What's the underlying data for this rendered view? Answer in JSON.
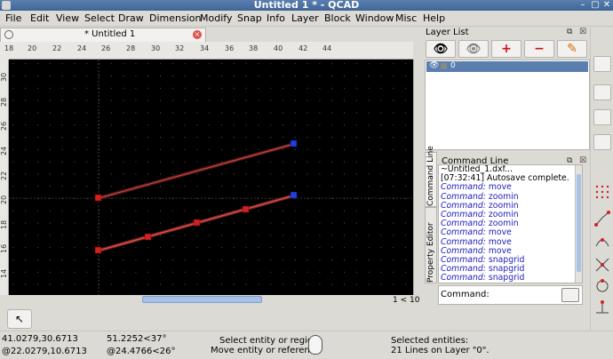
{
  "window": {
    "title": "Untitled 1 * - QCAD",
    "minimize_glyph": "–",
    "maximize_glyph": "▢",
    "close_glyph": "✕"
  },
  "menubar": {
    "items": [
      {
        "label": "File"
      },
      {
        "label": "Edit"
      },
      {
        "label": "View"
      },
      {
        "label": "Select"
      },
      {
        "label": "Draw"
      },
      {
        "label": "Dimension"
      },
      {
        "label": "Modify"
      },
      {
        "label": "Snap"
      },
      {
        "label": "Info"
      },
      {
        "label": "Layer"
      },
      {
        "label": "Block"
      },
      {
        "label": "Window"
      },
      {
        "label": "Misc"
      },
      {
        "label": "Help"
      }
    ]
  },
  "document_tab": {
    "label": "* Untitled 1",
    "close_glyph": "×"
  },
  "ruler": {
    "horizontal_ticks": [
      "20",
      "22",
      "24",
      "26",
      "28",
      "30",
      "32",
      "34",
      "36",
      "38",
      "40",
      "42",
      "44"
    ],
    "vertical_ticks": [
      "30",
      "28",
      "26",
      "24",
      "22",
      "20",
      "18",
      "16",
      "14",
      "12",
      "10",
      "8",
      "6",
      "4",
      "2"
    ],
    "horizontal_first": "18"
  },
  "canvas": {
    "background": "#000000",
    "grid_color": "#5a5a5a",
    "axis_color": "#8a8a8a",
    "line_color": "#b8322e",
    "endpoint_red": "#d42020",
    "endpoint_blue": "#2040e0"
  },
  "scroll": {
    "page_indicator": "1 < 10"
  },
  "layer_list": {
    "title": "Layer List",
    "buttons": {
      "show_all": "👁",
      "hide_all": "👁",
      "add": "+",
      "remove": "−",
      "edit": "✎"
    },
    "layers": [
      {
        "name": "0",
        "visible": true,
        "locked": false
      }
    ]
  },
  "command_line": {
    "title": "Command Line",
    "side_tabs": {
      "command_line": "Command Line",
      "property_editor": "Property Editor"
    },
    "history": [
      {
        "text": "~Untitled_1.dxf...",
        "kind": "info"
      },
      {
        "text": "[07:32:41] Autosave complete.",
        "kind": "info"
      },
      {
        "prefix": "Command:",
        "text": " move",
        "kind": "cmd"
      },
      {
        "prefix": "Command:",
        "text": " zoomin",
        "kind": "cmd"
      },
      {
        "prefix": "Command:",
        "text": " zoomin",
        "kind": "cmd"
      },
      {
        "prefix": "Command:",
        "text": " zoomin",
        "kind": "cmd"
      },
      {
        "prefix": "Command:",
        "text": " zoomin",
        "kind": "cmd"
      },
      {
        "prefix": "Command:",
        "text": " move",
        "kind": "cmd"
      },
      {
        "prefix": "Command:",
        "text": " move",
        "kind": "cmd"
      },
      {
        "prefix": "Command:",
        "text": " move",
        "kind": "cmd"
      },
      {
        "prefix": "Command:",
        "text": " snapgrid",
        "kind": "cmd"
      },
      {
        "prefix": "Command:",
        "text": " snapgrid",
        "kind": "cmd"
      },
      {
        "prefix": "Command:",
        "text": " snapgrid",
        "kind": "cmd"
      }
    ],
    "input_label": "Command:",
    "input_value": ""
  },
  "toolbar_bottom": {
    "select_glyph": "↖"
  },
  "status": {
    "abs_coord": "41.0279,30.6713",
    "rel_coord": "@22.0279,10.6713",
    "polar_coord": "51.2252<37°",
    "rel_polar_coord": "@24.4766<26°",
    "hint_left": "Select entity or region",
    "hint_right": "Move entity or reference",
    "selection_title": "Selected entities:",
    "selection_detail": "21 Lines on Layer \"0\"."
  }
}
